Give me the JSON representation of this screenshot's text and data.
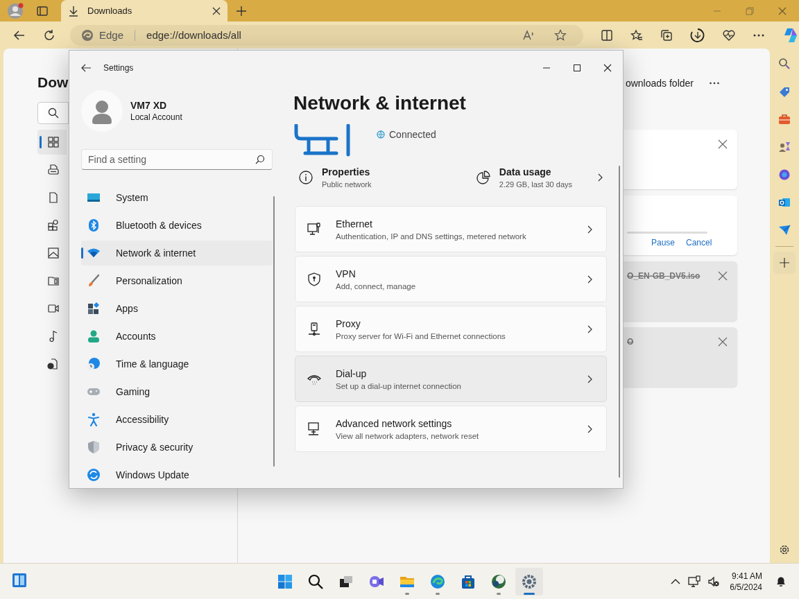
{
  "browser": {
    "tab": {
      "title": "Downloads"
    },
    "address": {
      "site_label": "Edge",
      "url": "edge://downloads/all"
    }
  },
  "downloads_page": {
    "title": "Dow",
    "nav": [
      {
        "kind": "all",
        "selected": true
      },
      {
        "kind": "document",
        "selected": false
      },
      {
        "kind": "file",
        "selected": false
      },
      {
        "kind": "apps",
        "selected": false
      },
      {
        "kind": "image",
        "selected": false
      },
      {
        "kind": "archive",
        "selected": false
      },
      {
        "kind": "video",
        "selected": false
      },
      {
        "kind": "music",
        "selected": false
      },
      {
        "kind": "other",
        "selected": false
      }
    ],
    "header_action": "ownloads folder",
    "items": [
      {
        "kind": "finished",
        "deleted": false
      },
      {
        "kind": "in_progress",
        "deleted": false,
        "actions": [
          "Pause",
          "Cancel"
        ]
      },
      {
        "kind": "finished",
        "deleted": true,
        "name": "O_EN-GB_DV5.iso"
      },
      {
        "kind": "finished",
        "deleted": true,
        "name": "O"
      }
    ]
  },
  "settings": {
    "title": "Settings",
    "user": {
      "name": "VM7 XD",
      "account_type": "Local Account"
    },
    "search": {
      "placeholder": "Find a setting"
    },
    "nav": [
      {
        "kind": "system",
        "label": "System",
        "selected": false
      },
      {
        "kind": "bluetooth",
        "label": "Bluetooth & devices",
        "selected": false
      },
      {
        "kind": "network",
        "label": "Network & internet",
        "selected": true
      },
      {
        "kind": "personalization",
        "label": "Personalization",
        "selected": false
      },
      {
        "kind": "apps",
        "label": "Apps",
        "selected": false
      },
      {
        "kind": "accounts",
        "label": "Accounts",
        "selected": false
      },
      {
        "kind": "time",
        "label": "Time & language",
        "selected": false
      },
      {
        "kind": "gaming",
        "label": "Gaming",
        "selected": false
      },
      {
        "kind": "accessibility",
        "label": "Accessibility",
        "selected": false
      },
      {
        "kind": "privacy",
        "label": "Privacy & security",
        "selected": false
      },
      {
        "kind": "update",
        "label": "Windows Update",
        "selected": false
      }
    ],
    "page": {
      "title": "Network & internet",
      "status": "Connected",
      "properties": {
        "title": "Properties",
        "subtitle": "Public network"
      },
      "data_usage": {
        "title": "Data usage",
        "subtitle": "2.29 GB, last 30 days"
      },
      "cards": [
        {
          "kind": "ethernet",
          "title": "Ethernet",
          "subtitle": "Authentication, IP and DNS settings, metered network",
          "hovered": false
        },
        {
          "kind": "vpn",
          "title": "VPN",
          "subtitle": "Add, connect, manage",
          "hovered": false
        },
        {
          "kind": "proxy",
          "title": "Proxy",
          "subtitle": "Proxy server for Wi-Fi and Ethernet connections",
          "hovered": false
        },
        {
          "kind": "dialup",
          "title": "Dial-up",
          "subtitle": "Set up a dial-up internet connection",
          "hovered": true
        },
        {
          "kind": "advanced",
          "title": "Advanced network settings",
          "subtitle": "View all network adapters, network reset",
          "hovered": false
        }
      ]
    }
  },
  "taskbar": {
    "apps": [
      {
        "kind": "start",
        "running": false,
        "active": false
      },
      {
        "kind": "search",
        "running": false,
        "active": false
      },
      {
        "kind": "taskview",
        "running": false,
        "active": false
      },
      {
        "kind": "chat",
        "running": false,
        "active": false
      },
      {
        "kind": "explorer",
        "running": true,
        "active": false
      },
      {
        "kind": "edge",
        "running": true,
        "active": false
      },
      {
        "kind": "store",
        "running": false,
        "active": false
      },
      {
        "kind": "globe",
        "running": true,
        "active": false
      },
      {
        "kind": "settings",
        "running": true,
        "active": true
      }
    ],
    "clock": {
      "time": "9:41 AM",
      "date": "6/5/2024"
    }
  }
}
